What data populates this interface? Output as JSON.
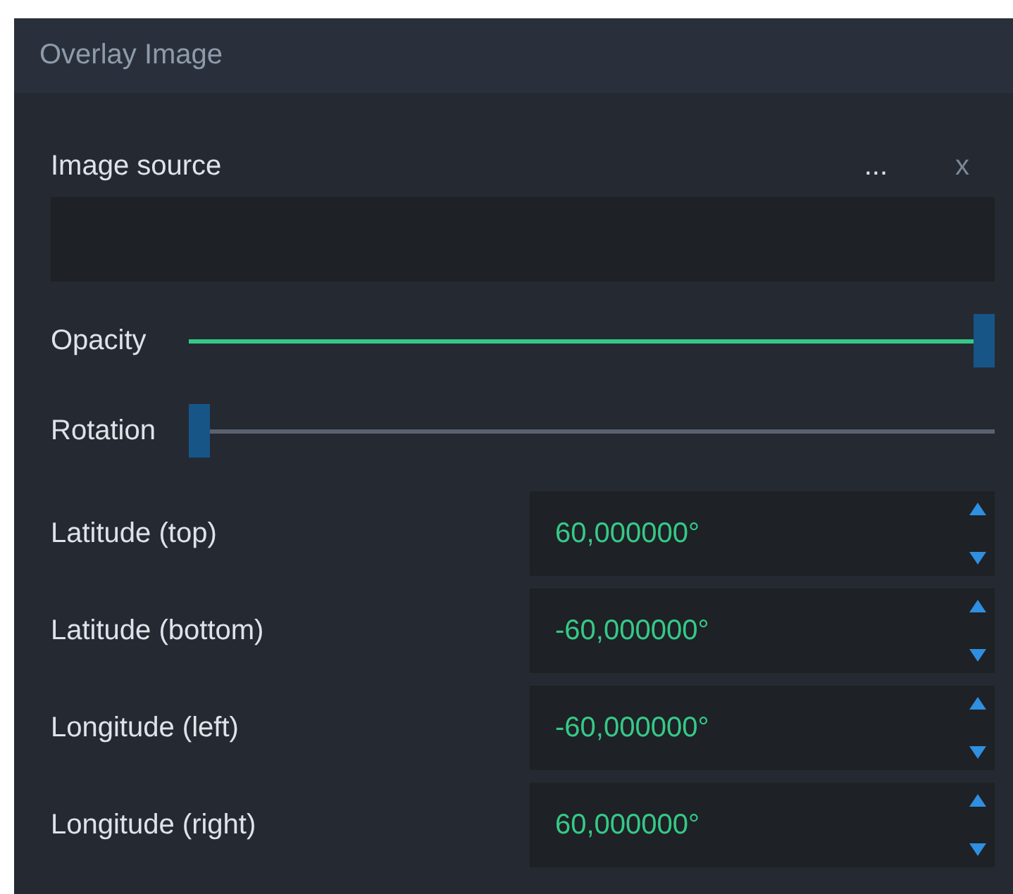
{
  "panel": {
    "title": "Overlay Image"
  },
  "image_source": {
    "label": "Image source",
    "browse": "...",
    "clear": "x"
  },
  "sliders": [
    {
      "label": "Opacity",
      "level": 1
    },
    {
      "label": "Rotation",
      "level": 0
    }
  ],
  "fields": [
    {
      "label": "Latitude (top)",
      "value": "60,000000°"
    },
    {
      "label": "Latitude (bottom)",
      "value": "-60,000000°"
    },
    {
      "label": "Longitude (left)",
      "value": "-60,000000°"
    },
    {
      "label": "Longitude (right)",
      "value": "60,000000°"
    }
  ]
}
